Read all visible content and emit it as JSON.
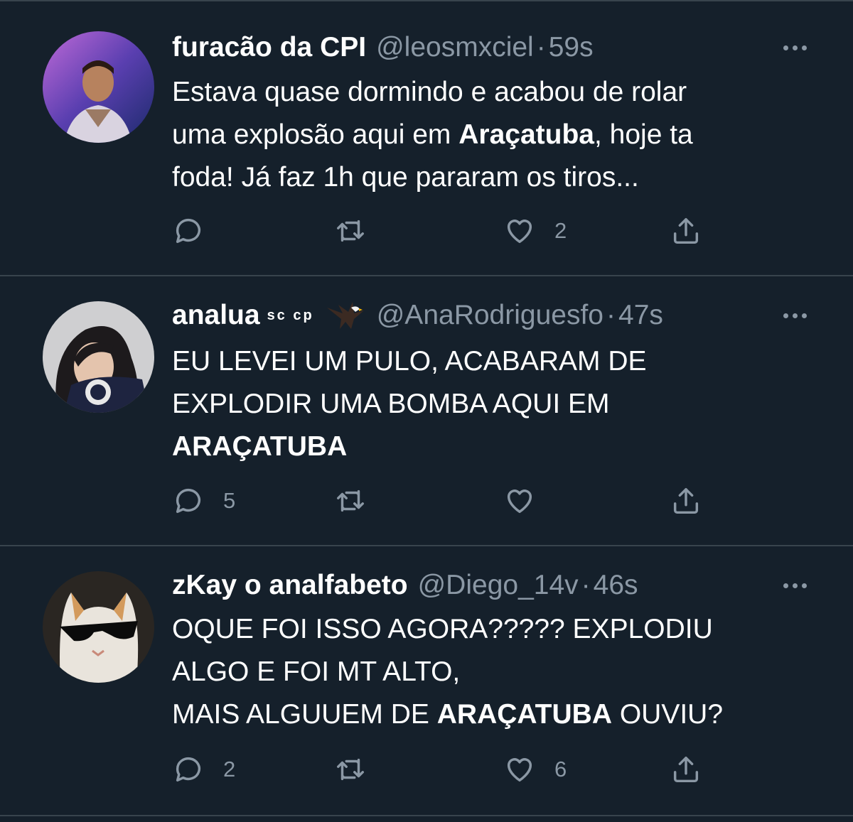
{
  "tweets": [
    {
      "name": "furacão da CPI",
      "handle": "@leosmxciel",
      "separator": "·",
      "time": "59s",
      "text_line1": "Estava quase dormindo e acabou de rolar",
      "text_line2_pre": "uma explosão aqui em ",
      "text_line2_bold": "Araçatuba",
      "text_line2_post": ", hoje ta",
      "text_line3": "foda! Já faz 1h que pararam os tiros...",
      "replies": "",
      "retweets": "",
      "likes": "2"
    },
    {
      "name": "analua",
      "badge": "sc cp",
      "handle": "@AnaRodriguesfo",
      "separator": "·",
      "time": "47s",
      "text_line1": "EU LEVEI UM PULO, ACABARAM DE",
      "text_line2": "EXPLODIR UMA BOMBA AQUI EM",
      "text_line3_bold": "ARAÇATUBA",
      "replies": "5",
      "retweets": "",
      "likes": ""
    },
    {
      "name": "zKay o analfabeto",
      "handle": "@Diego_14v",
      "separator": "·",
      "time": "46s",
      "text_line1": "OQUE FOI ISSO AGORA????? EXPLODIU",
      "text_line2": "ALGO E FOI MT ALTO,",
      "text_line3_pre": "MAIS ALGUUEM DE ",
      "text_line3_bold": "ARAÇATUBA",
      "text_line3_post": " OUVIU?",
      "replies": "2",
      "retweets": "",
      "likes": "6"
    }
  ],
  "icons": {
    "reply": "reply-icon",
    "retweet": "retweet-icon",
    "like": "heart-icon",
    "share": "share-icon",
    "more": "more-icon"
  },
  "colors": {
    "background": "#15202b",
    "secondary_text": "#8b98a5",
    "divider": "#38444d"
  }
}
